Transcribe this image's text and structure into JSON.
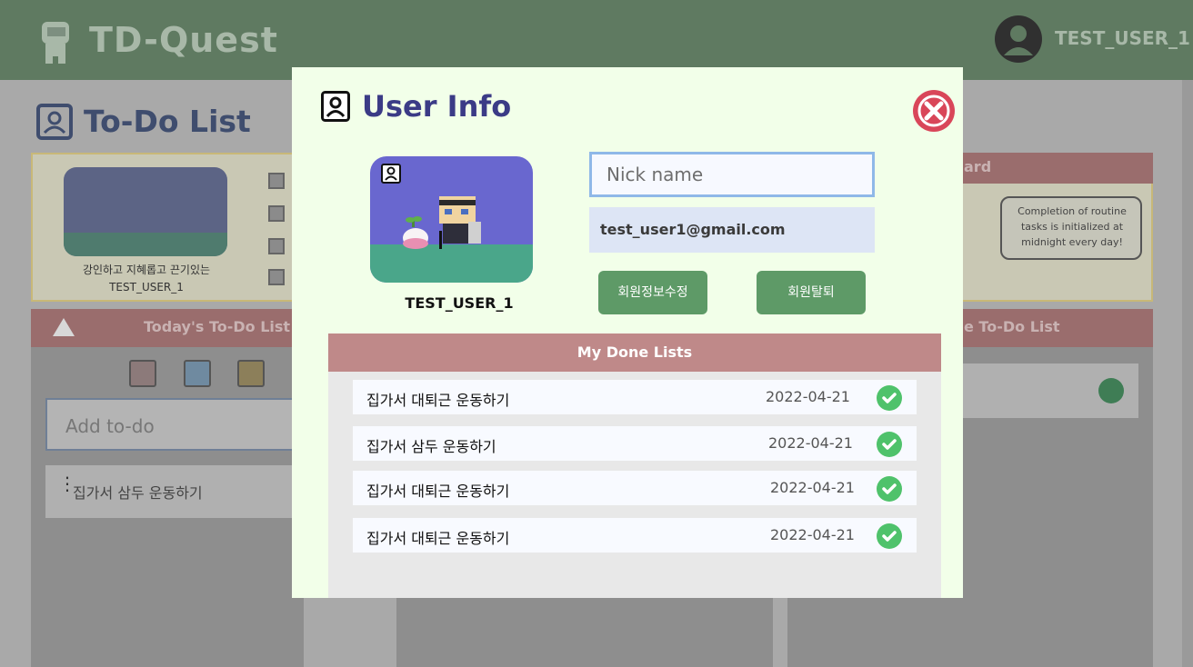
{
  "app": {
    "logo_text": "TD-Quest",
    "user_name": "TEST_USER_1"
  },
  "page": {
    "title": "To-Do List",
    "profile_caption_line1": "강인하고 지혜롭고 끈기있는",
    "profile_caption_line2": "TEST_USER_1",
    "today_list_title": "Today's To-Do List",
    "add_todo_placeholder": "Add to-do",
    "todo_items": [
      "집가서 삼두 운동하기"
    ],
    "right_head1_label": "ard",
    "right_head2_label": "e To-Do List",
    "speech_text": "Completion of routine tasks is initialized at midnight every day!"
  },
  "modal": {
    "title": "User Info",
    "user_name": "TEST_USER_1",
    "nickname_placeholder": "Nick name",
    "nickname_value": "",
    "email": "test_user1@gmail.com",
    "edit_button_label": "회원정보수정",
    "delete_button_label": "회원탈퇴",
    "done_title": "My Done Lists",
    "done_items": [
      {
        "text": "집가서 대퇴근 운동하기",
        "date": "2022-04-21"
      },
      {
        "text": "집가서 삼두 운동하기",
        "date": "2022-04-21"
      },
      {
        "text": "집가서 대퇴근 운동하기",
        "date": "2022-04-21"
      },
      {
        "text": "집가서 대퇴근 운동하기",
        "date": "2022-04-21"
      }
    ]
  },
  "colors": {
    "modal_bg": "#f2ffe9",
    "title_color": "#3b3b86",
    "button_green": "#5e9a67",
    "done_header": "#bf8989",
    "check_green": "#4fc26b",
    "close_red": "#d94659"
  }
}
